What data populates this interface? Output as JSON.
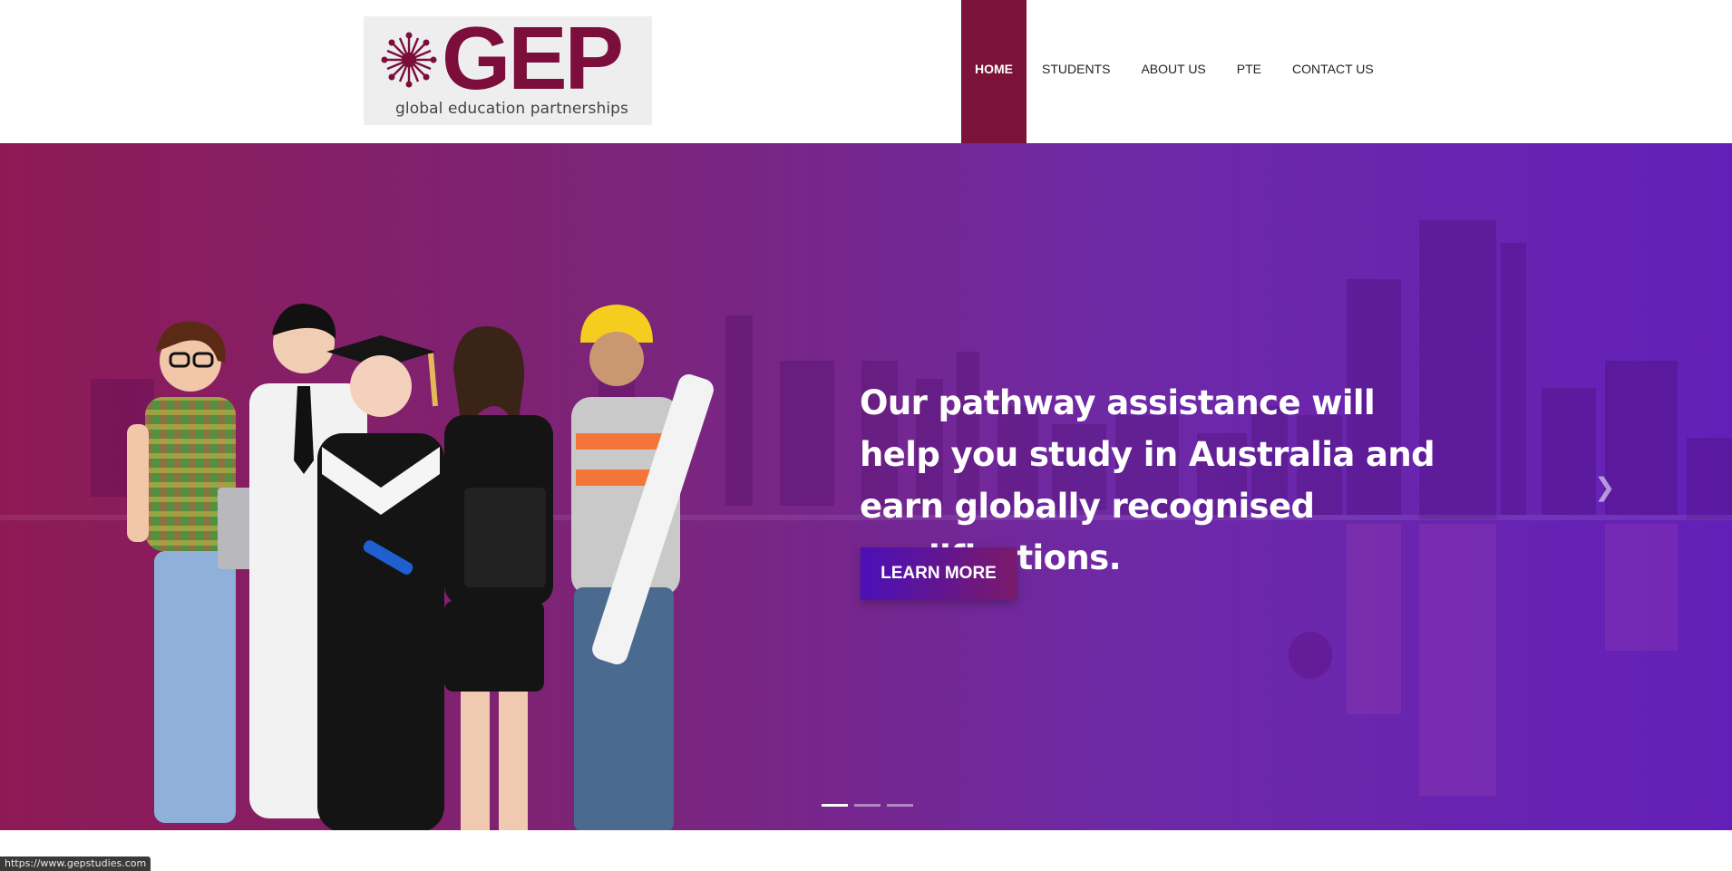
{
  "logo": {
    "wordmark": "GEP",
    "tagline": "global education partnerships",
    "brand_color": "#7b0e3b",
    "icon": "flower-icon"
  },
  "nav": {
    "items": [
      {
        "label": "HOME",
        "active": true
      },
      {
        "label": "STUDENTS",
        "active": false
      },
      {
        "label": "ABOUT US",
        "active": false
      },
      {
        "label": "PTE",
        "active": false
      },
      {
        "label": "CONTACT US",
        "active": false
      }
    ],
    "active_color": "#7b1238"
  },
  "hero": {
    "headline": "Our pathway assistance will help you study in Australia and earn globally recognised qualifications.",
    "cta_label": "LEARN MORE",
    "next_icon": "chevron-right-icon",
    "slides": 3,
    "active_slide": 1,
    "gradient_colors": [
      "#8e1a55",
      "#6320b8"
    ]
  },
  "status_bar": {
    "url": "https://www.gepstudies.com"
  }
}
